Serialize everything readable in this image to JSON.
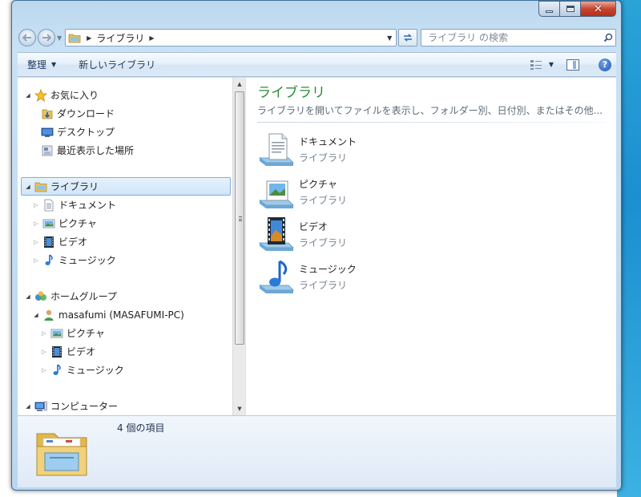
{
  "window": {
    "close_glyph": "✕"
  },
  "address_bar": {
    "path_segment": "ライブラリ",
    "search_placeholder": "ライブラリ の検索"
  },
  "command_bar": {
    "organize_label": "整理",
    "new_library_label": "新しいライブラリ",
    "help_glyph": "?"
  },
  "navigation": {
    "favorites": {
      "label": "お気に入り",
      "items": [
        {
          "label": "ダウンロード",
          "icon": "download-folder-icon"
        },
        {
          "label": "デスクトップ",
          "icon": "desktop-icon"
        },
        {
          "label": "最近表示した場所",
          "icon": "recent-places-icon"
        }
      ]
    },
    "libraries": {
      "label": "ライブラリ",
      "items": [
        {
          "label": "ドキュメント",
          "icon": "documents-icon"
        },
        {
          "label": "ピクチャ",
          "icon": "pictures-icon"
        },
        {
          "label": "ビデオ",
          "icon": "videos-icon"
        },
        {
          "label": "ミュージック",
          "icon": "music-icon"
        }
      ]
    },
    "homegroup": {
      "label": "ホームグループ",
      "user": "masafumi (MASAFUMI-PC)",
      "items": [
        {
          "label": "ピクチャ",
          "icon": "pictures-icon"
        },
        {
          "label": "ビデオ",
          "icon": "videos-icon"
        },
        {
          "label": "ミュージック",
          "icon": "music-icon"
        }
      ]
    },
    "computer": {
      "label": "コンピューター"
    }
  },
  "main": {
    "title": "ライブラリ",
    "description": "ライブラリを開いてファイルを表示し、フォルダー別、日付別、またはその他...",
    "libraries": [
      {
        "name": "ドキュメント",
        "type": "ライブラリ",
        "icon": "documents-library-icon"
      },
      {
        "name": "ピクチャ",
        "type": "ライブラリ",
        "icon": "pictures-library-icon"
      },
      {
        "name": "ビデオ",
        "type": "ライブラリ",
        "icon": "videos-library-icon"
      },
      {
        "name": "ミュージック",
        "type": "ライブラリ",
        "icon": "music-library-icon"
      }
    ]
  },
  "details": {
    "item_count": "4 個の項目"
  },
  "colors": {
    "title_green": "#2e8b3c",
    "selection_border": "#84acdd",
    "command_text": "#1e395b"
  }
}
